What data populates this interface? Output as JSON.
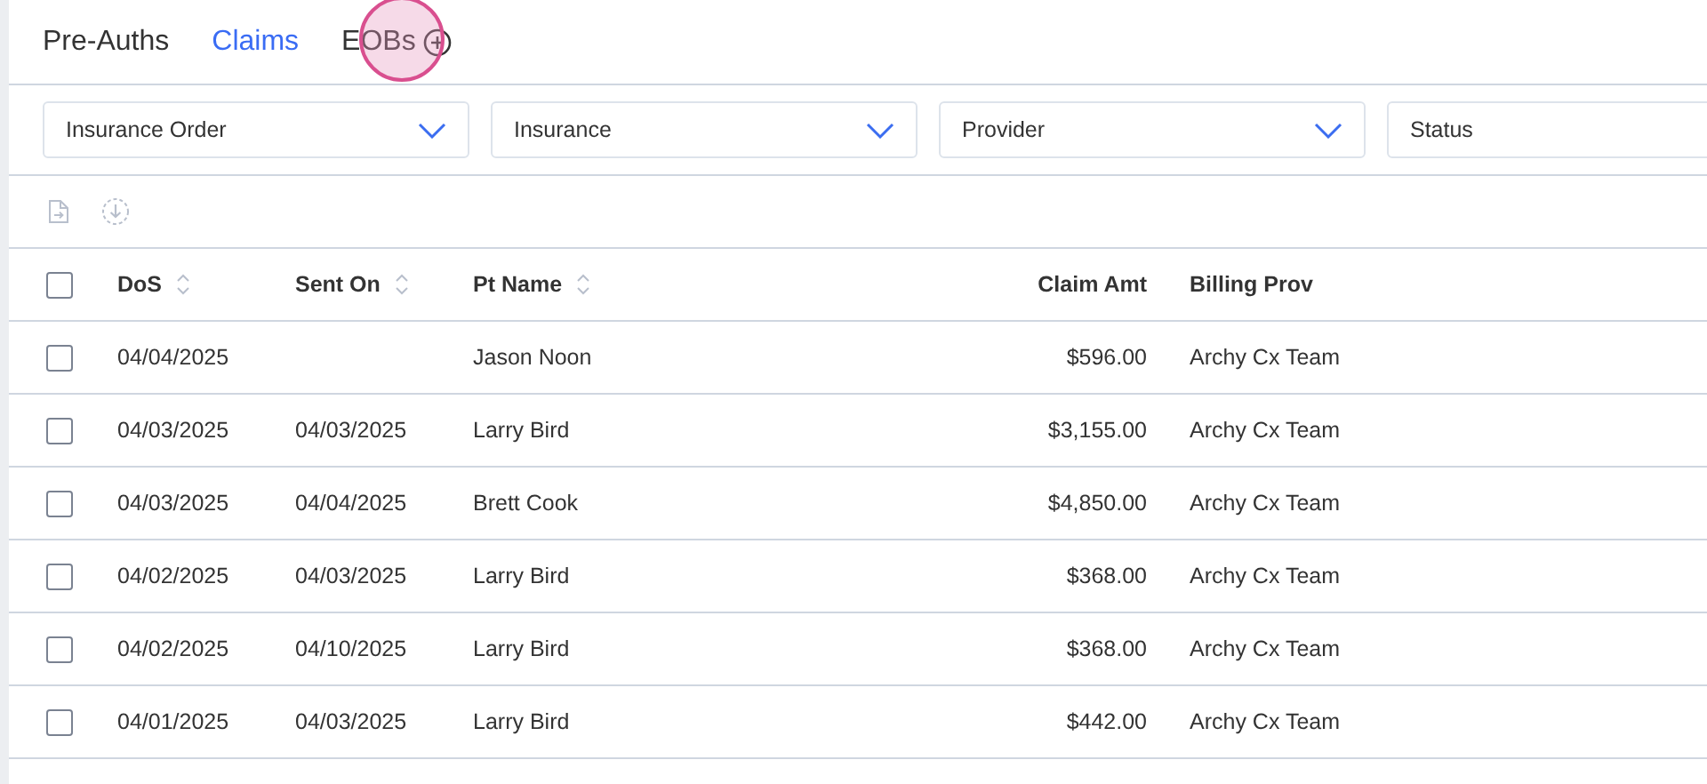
{
  "tabs": [
    {
      "label": "Pre-Auths",
      "selected": false
    },
    {
      "label": "Claims",
      "selected": true
    },
    {
      "label": "EOBs",
      "selected": false
    }
  ],
  "filters": [
    {
      "label": "Insurance Order"
    },
    {
      "label": "Insurance"
    },
    {
      "label": "Provider"
    },
    {
      "label": "Status"
    }
  ],
  "table": {
    "columns": [
      {
        "label": "DoS",
        "sortable": true,
        "kind": "text"
      },
      {
        "label": "Sent On",
        "sortable": true,
        "kind": "text"
      },
      {
        "label": "Pt Name",
        "sortable": true,
        "kind": "text"
      },
      {
        "label": "Claim Amt",
        "sortable": false,
        "kind": "amount"
      },
      {
        "label": "Billing Prov",
        "sortable": false,
        "kind": "text"
      }
    ],
    "header_checked": false,
    "rows": [
      {
        "checked": false,
        "cells": [
          "04/04/2025",
          "",
          "Jason Noon",
          "$596.00",
          "Archy Cx Team"
        ]
      },
      {
        "checked": false,
        "cells": [
          "04/03/2025",
          "04/03/2025",
          "Larry Bird",
          "$3,155.00",
          "Archy Cx Team"
        ]
      },
      {
        "checked": false,
        "cells": [
          "04/03/2025",
          "04/04/2025",
          "Brett Cook",
          "$4,850.00",
          "Archy Cx Team"
        ]
      },
      {
        "checked": false,
        "cells": [
          "04/02/2025",
          "04/03/2025",
          "Larry Bird",
          "$368.00",
          "Archy Cx Team"
        ]
      },
      {
        "checked": false,
        "cells": [
          "04/02/2025",
          "04/10/2025",
          "Larry Bird",
          "$368.00",
          "Archy Cx Team"
        ]
      },
      {
        "checked": false,
        "cells": [
          "04/01/2025",
          "04/03/2025",
          "Larry Bird",
          "$442.00",
          "Archy Cx Team"
        ]
      }
    ]
  }
}
